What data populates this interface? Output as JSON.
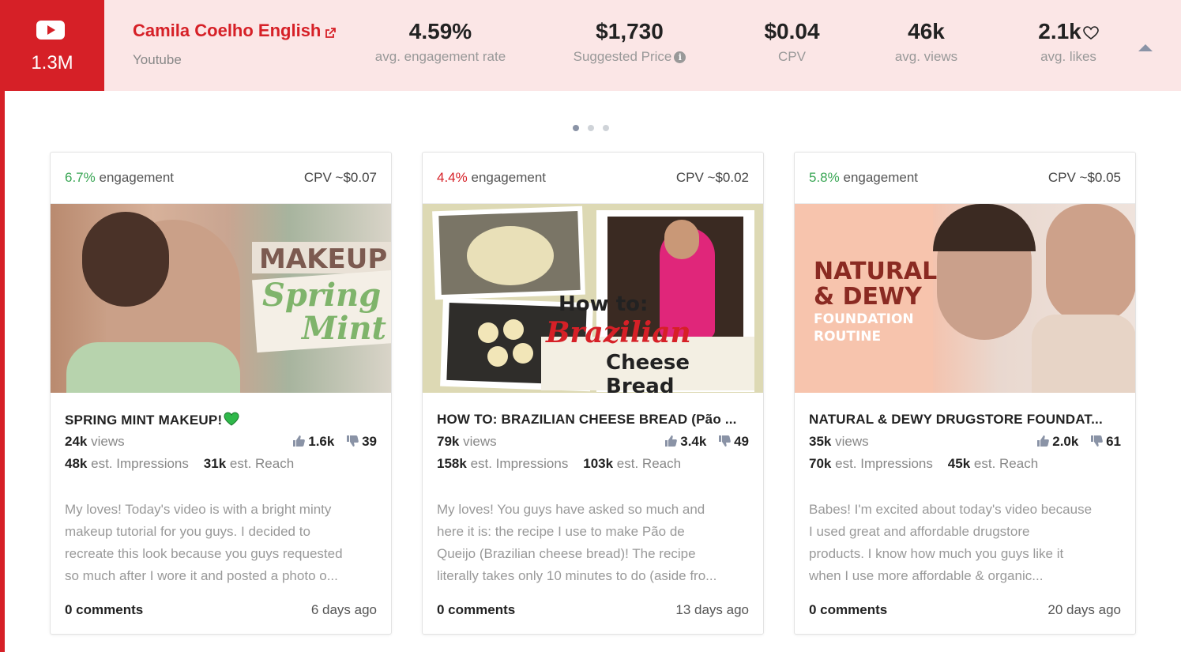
{
  "header": {
    "subscribers": "1.3M",
    "channel_name": "Camila Coelho English",
    "platform": "Youtube",
    "stats": [
      {
        "value": "4.59%",
        "label": "avg. engagement rate"
      },
      {
        "value": "$1,730",
        "label": "Suggested Price"
      },
      {
        "value": "$0.04",
        "label": "CPV"
      },
      {
        "value": "46k",
        "label": "avg. views"
      },
      {
        "value": "2.1k",
        "label": "avg. likes"
      }
    ],
    "colors": {
      "brand": "#d62027",
      "header_bg": "#fbe6e6",
      "positive": "#3aa655"
    }
  },
  "carousel": {
    "pages": 3,
    "active": 1
  },
  "cards": [
    {
      "engagement_pct": "6.7%",
      "engagement_label": "engagement",
      "cpv": "CPV ~$0.07",
      "thumb_lines": [
        "MAKEUP",
        "Spring",
        "Mint"
      ],
      "title": "SPRING MINT MAKEUP!",
      "views": "24k",
      "views_label": "views",
      "likes": "1.6k",
      "dislikes": "39",
      "impressions": "48k",
      "impressions_label": "est. Impressions",
      "reach": "31k",
      "reach_label": "est. Reach",
      "desc": [
        "My loves! Today's video is with a bright minty",
        "makeup tutorial for you guys. I decided to",
        "recreate this look because you guys requested",
        "so much after I wore it and posted a photo o..."
      ],
      "comments": "0 comments",
      "ago": "6 days ago"
    },
    {
      "engagement_pct": "4.4%",
      "engagement_label": "engagement",
      "cpv": "CPV ~$0.02",
      "thumb_lines": [
        "How to:",
        "Brazilian",
        "Cheese Bread"
      ],
      "title": "HOW TO: BRAZILIAN CHEESE BREAD (Pão ...",
      "views": "79k",
      "views_label": "views",
      "likes": "3.4k",
      "dislikes": "49",
      "impressions": "158k",
      "impressions_label": "est. Impressions",
      "reach": "103k",
      "reach_label": "est. Reach",
      "desc": [
        "My loves! You guys have asked so much and",
        "here it is: the recipe I use to make Pão de",
        "Queijo (Brazilian cheese bread)! The recipe",
        "literally takes only 10 minutes to do (aside fro..."
      ],
      "comments": "0 comments",
      "ago": "13 days ago"
    },
    {
      "engagement_pct": "5.8%",
      "engagement_label": "engagement",
      "cpv": "CPV ~$0.05",
      "thumb_lines": [
        "NATURAL",
        "& DEWY",
        "FOUNDATION",
        "ROUTINE"
      ],
      "title": "NATURAL & DEWY DRUGSTORE FOUNDAT...",
      "views": "35k",
      "views_label": "views",
      "likes": "2.0k",
      "dislikes": "61",
      "impressions": "70k",
      "impressions_label": "est. Impressions",
      "reach": "45k",
      "reach_label": "est. Reach",
      "desc": [
        "Babes! I'm excited about today's video because",
        "I used great and affordable drugstore",
        "products. I know how much you guys like it",
        "when I use more affordable & organic..."
      ],
      "comments": "0 comments",
      "ago": "20 days ago"
    }
  ]
}
